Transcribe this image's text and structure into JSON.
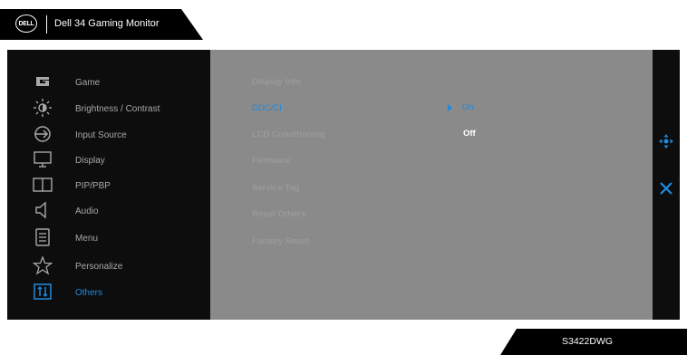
{
  "header": {
    "logo_text": "DELL",
    "title": "Dell 34 Gaming Monitor"
  },
  "menu": {
    "items": [
      {
        "label": "Game",
        "icon": "game-icon"
      },
      {
        "label": "Brightness / Contrast",
        "icon": "brightness-icon"
      },
      {
        "label": "Input Source",
        "icon": "input-source-icon"
      },
      {
        "label": "Display",
        "icon": "display-icon"
      },
      {
        "label": "PIP/PBP",
        "icon": "pip-pbp-icon"
      },
      {
        "label": "Audio",
        "icon": "audio-icon"
      },
      {
        "label": "Menu",
        "icon": "menu-icon"
      },
      {
        "label": "Personalize",
        "icon": "star-icon"
      },
      {
        "label": "Others",
        "icon": "others-icon"
      }
    ],
    "active_index": 8
  },
  "submenu": {
    "items": [
      {
        "label": "Display Info"
      },
      {
        "label": "DDC/CI"
      },
      {
        "label": "LCD Conditioning"
      },
      {
        "label": "Firmware"
      },
      {
        "label": "Service Tag"
      },
      {
        "label": "Reset Others"
      },
      {
        "label": "Factory Reset"
      }
    ],
    "active_index": 1,
    "options": {
      "on": "On",
      "off": "Off"
    }
  },
  "footer": {
    "model": "S3422DWG"
  },
  "colors": {
    "accent": "#1e8be0",
    "panel": "#0d0d0d",
    "submenu_bg": "#8a8a8a"
  }
}
